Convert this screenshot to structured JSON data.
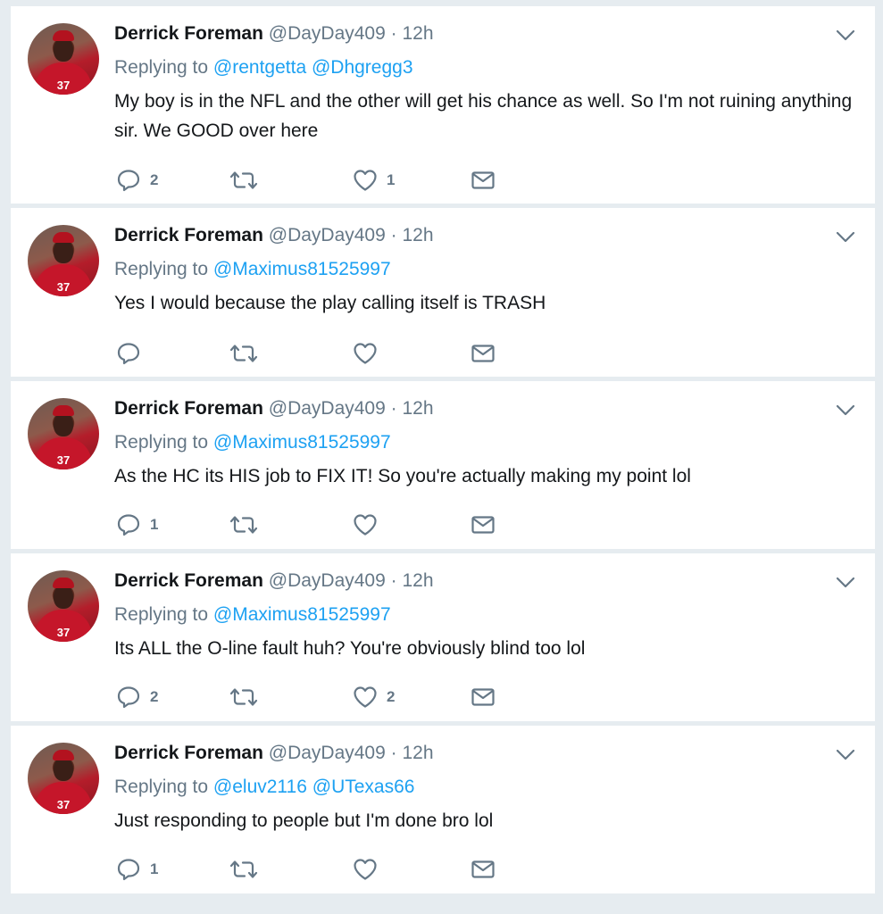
{
  "tweets": [
    {
      "name": "Derrick Foreman",
      "handle": "@DayDay409",
      "dot": "·",
      "time": "12h",
      "reply_prefix": "Replying to",
      "mentions": [
        "@rentgetta",
        "@Dhgregg3"
      ],
      "text": "My boy is in the NFL and the other will get his chance as well. So I'm not ruining anything sir. We GOOD over here",
      "replies": "2",
      "retweets": "",
      "likes": "1"
    },
    {
      "name": "Derrick Foreman",
      "handle": "@DayDay409",
      "dot": "·",
      "time": "12h",
      "reply_prefix": "Replying to",
      "mentions": [
        "@Maximus81525997"
      ],
      "text": "Yes I would because the play calling itself is TRASH",
      "replies": "",
      "retweets": "",
      "likes": ""
    },
    {
      "name": "Derrick Foreman",
      "handle": "@DayDay409",
      "dot": "·",
      "time": "12h",
      "reply_prefix": "Replying to",
      "mentions": [
        "@Maximus81525997"
      ],
      "text": "As the HC its HIS job to FIX IT! So you're actually making my point lol",
      "replies": "1",
      "retweets": "",
      "likes": ""
    },
    {
      "name": "Derrick Foreman",
      "handle": "@DayDay409",
      "dot": "·",
      "time": "12h",
      "reply_prefix": "Replying to",
      "mentions": [
        "@Maximus81525997"
      ],
      "text": "Its ALL the O-line fault huh? You're obviously blind too lol",
      "replies": "2",
      "retweets": "",
      "likes": "2"
    },
    {
      "name": "Derrick Foreman",
      "handle": "@DayDay409",
      "dot": "·",
      "time": "12h",
      "reply_prefix": "Replying to",
      "mentions": [
        "@eluv2116",
        "@UTexas66"
      ],
      "text": "Just responding to people but I'm done bro lol",
      "replies": "1",
      "retweets": "",
      "likes": ""
    }
  ],
  "icons": {
    "reply": "reply-icon",
    "retweet": "retweet-icon",
    "like": "heart-icon",
    "dm": "envelope-icon",
    "caret": "chevron-down-icon"
  },
  "colors": {
    "link": "#1da1f2",
    "muted": "#657786",
    "text": "#14171a",
    "background": "#e6ecf0"
  }
}
